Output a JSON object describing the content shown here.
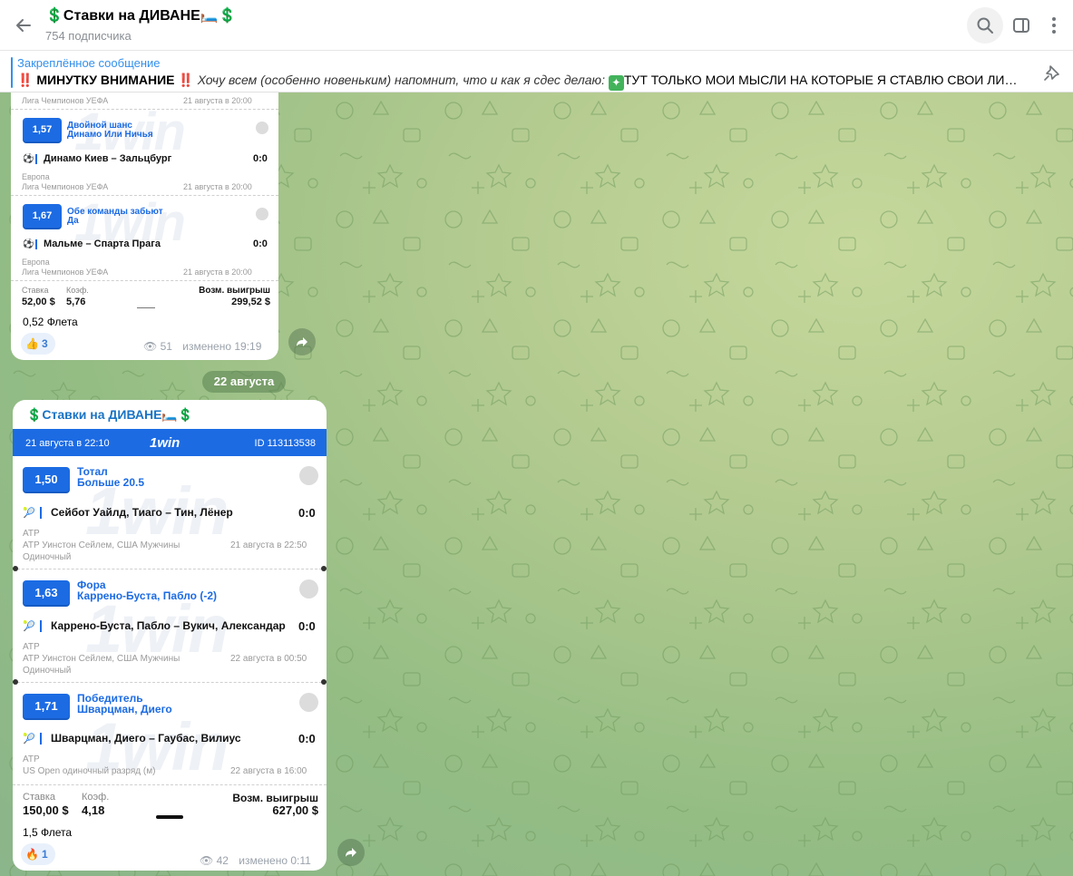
{
  "header": {
    "channel_title": "💲Ставки на ДИВАНЕ🛏️💲",
    "subscribers": "754 подписчика"
  },
  "pinned": {
    "label": "Закреплённое сообщение",
    "prefix": "‼️ МИНУТКУ ВНИМАНИЕ ‼️",
    "italic": "Хочу всем (особенно новеньким) напомнит, что и как я сдес делаю:",
    "rest": "ТУТ ТОЛЬКО МОИ МЫСЛИ НА КОТОРЫЕ Я СТАВЛЮ СВОИ ЛИЧНЫЕ СРЕДС..."
  },
  "message1": {
    "top_meta": {
      "league": "Лига Чемпионов УЕФА",
      "time": "21 августа в 20:00"
    },
    "legs": [
      {
        "coef": "1,57",
        "type": "Двойной шанс",
        "pick": "Динамо Или Ничья",
        "match": "Динамо Киев – Зальцбург",
        "score": "0:0",
        "region": "Европа",
        "league": "Лига Чемпионов УЕФА",
        "time": "21 августа в 20:00"
      },
      {
        "coef": "1,67",
        "type": "Обе команды забьют",
        "pick": "Да",
        "match": "Мальме – Спарта Прага",
        "score": "0:0",
        "region": "Европа",
        "league": "Лига Чемпионов УЕФА",
        "time": "21 августа в 20:00"
      }
    ],
    "totals": {
      "stake_label": "Ставка",
      "stake": "52,00 $",
      "coef_label": "Коэф.",
      "coef": "5,76",
      "win_label": "Возм. выигрыш",
      "win": "299,52 $"
    },
    "caption": "0,52 Флета",
    "reaction": {
      "emoji": "👍",
      "count": "3"
    },
    "views": "51",
    "edited": "изменено 19:19"
  },
  "date_pill": "22 августа",
  "message2": {
    "forward_from": "💲Ставки на ДИВАНЕ🛏️💲",
    "ticket_date": "21 августа в 22:10",
    "brand": "1win",
    "ticket_id": "ID 113113538",
    "legs": [
      {
        "coef": "1,50",
        "type": "Тотал",
        "pick": "Больше 20.5",
        "match": "Сейбот Уайлд, Тиаго – Тин, Лёнер",
        "score": "0:0",
        "region": "ATP",
        "league": "ATP Уинстон Сейлем, США Мужчины",
        "time": "21 августа в 22:50",
        "kind": "Одиночный"
      },
      {
        "coef": "1,63",
        "type": "Фора",
        "pick": "Каррено-Буста, Пабло (-2)",
        "match": "Каррено-Буста, Пабло – Вукич, Александар",
        "score": "0:0",
        "region": "ATP",
        "league": "ATP Уинстон Сейлем, США Мужчины",
        "time": "22 августа в 00:50",
        "kind": "Одиночный"
      },
      {
        "coef": "1,71",
        "type": "Победитель",
        "pick": "Шварцман, Диего",
        "match": "Шварцман, Диего – Гаубас, Вилиус",
        "score": "0:0",
        "region": "ATP",
        "league": "US Open одиночный разряд (м)",
        "time": "22 августа в 16:00",
        "kind": ""
      }
    ],
    "totals": {
      "stake_label": "Ставка",
      "stake": "150,00 $",
      "coef_label": "Коэф.",
      "coef": "4,18",
      "win_label": "Возм. выигрыш",
      "win": "627,00 $"
    },
    "caption": "1,5 Флета",
    "reaction": {
      "emoji": "🔥",
      "count": "1"
    },
    "views": "42",
    "edited": "изменено 0:11"
  },
  "colors": {
    "accent": "#3390ec",
    "brand_blue": "#1c6be3"
  }
}
